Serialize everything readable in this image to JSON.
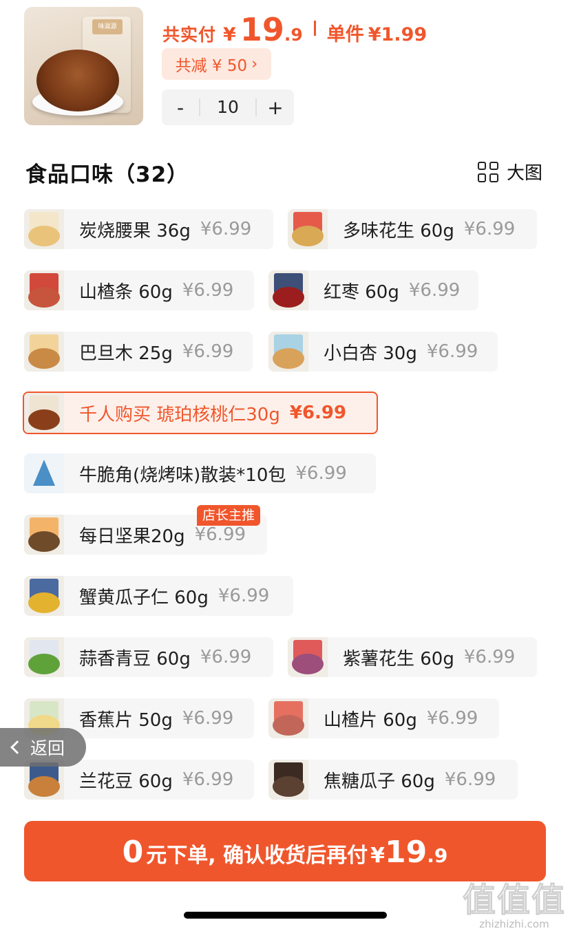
{
  "product": {
    "total_label": "共实付",
    "currency": "¥",
    "total_integer": "19",
    "total_decimal": ".9",
    "unit_label": "单件",
    "unit_price": "¥1.99",
    "discount_text": "共减 ¥ 50",
    "discount_arrow": "›",
    "thumb_brand": "味滋源"
  },
  "stepper": {
    "minus": "-",
    "quantity": "10",
    "plus": "+"
  },
  "section": {
    "title": "食品口味（32）",
    "view_label": "大图"
  },
  "variants": [
    {
      "name": "炭烧腰果 36g",
      "price": "¥6.99"
    },
    {
      "name": "多味花生 60g",
      "price": "¥6.99"
    },
    {
      "name": "山楂条 60g",
      "price": "¥6.99"
    },
    {
      "name": "红枣 60g",
      "price": "¥6.99"
    },
    {
      "name": "巴旦木 25g",
      "price": "¥6.99"
    },
    {
      "name": "小白杏 30g",
      "price": "¥6.99"
    },
    {
      "name": "千人购买  琥珀核桃仁30g",
      "price": "¥6.99",
      "selected": true
    },
    {
      "name": "牛脆角(烧烤味)散装*10包",
      "price": "¥6.99"
    },
    {
      "name": "每日坚果20g",
      "price": "¥6.99",
      "badge": "店长主推"
    },
    {
      "name": "蟹黄瓜子仁 60g",
      "price": "¥6.99"
    },
    {
      "name": "蒜香青豆 60g",
      "price": "¥6.99"
    },
    {
      "name": "紫薯花生 60g",
      "price": "¥6.99"
    },
    {
      "name": "香蕉片 50g",
      "price": "¥6.99"
    },
    {
      "name": "山楂片 60g",
      "price": "¥6.99"
    },
    {
      "name": "兰花豆 60g",
      "price": "¥6.99"
    },
    {
      "name": "焦糖瓜子 60g",
      "price": "¥6.99"
    }
  ],
  "back": {
    "label": "返回"
  },
  "cta": {
    "zero": "0",
    "text": "元下单, 确认收货后再付",
    "currency": "¥",
    "integer": "19",
    "decimal": ".9"
  },
  "watermark": {
    "big": "值值值",
    "small": "zhizhizhi.com"
  },
  "colors": {
    "accent": "#f0562c",
    "accent_light": "#fde9df",
    "chip_bg": "#f6f6f6"
  }
}
